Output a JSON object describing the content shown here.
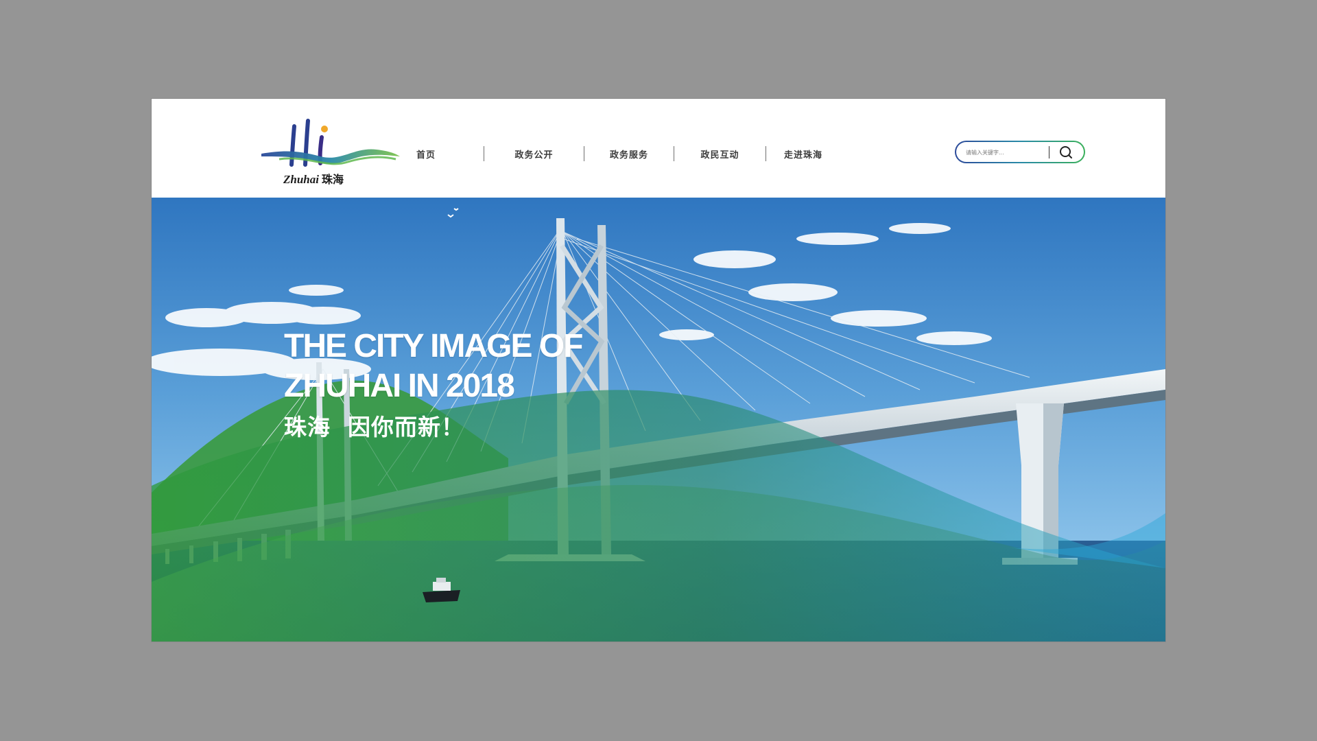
{
  "brand": {
    "logo_text": "Hi",
    "wordmark_latin": "Zhuhai",
    "wordmark_cn": "珠海"
  },
  "nav": {
    "items": [
      {
        "label": "首页"
      },
      {
        "label": "政务公开"
      },
      {
        "label": "政务服务"
      },
      {
        "label": "政民互动"
      },
      {
        "label": "走进珠海"
      }
    ]
  },
  "search": {
    "placeholder": "请输入关键字...",
    "icon": "search-icon"
  },
  "hero": {
    "headline_line1": "THE CITY IMAGE OF",
    "headline_line2": "ZHUHAI IN 2018",
    "slogan": "珠海  因你而新！"
  },
  "colors": {
    "page_background": "#959595",
    "header_background": "#ffffff",
    "brand_blue": "#2c4a9a",
    "brand_green": "#3ab05a",
    "sky": "#3f86c8",
    "sea": "#1d4f86"
  }
}
